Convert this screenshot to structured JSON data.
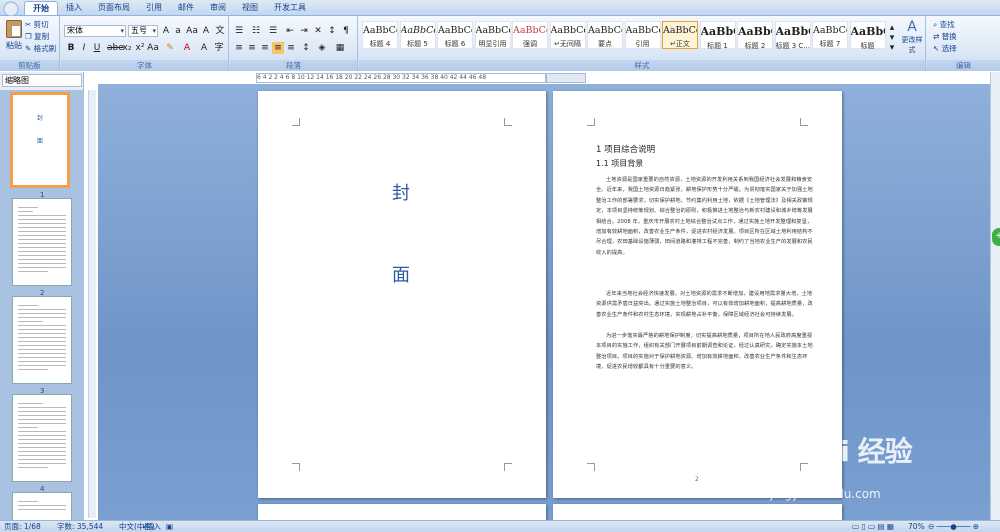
{
  "tabs": [
    "开始",
    "插入",
    "页面布局",
    "引用",
    "邮件",
    "审阅",
    "视图",
    "开发工具"
  ],
  "ribbon": {
    "clipboard": {
      "paste": "粘贴",
      "cut": "剪切",
      "copy": "复制",
      "format_painter": "格式刷",
      "label": "剪贴板"
    },
    "font": {
      "font_name": "宋体",
      "font_size": "五号",
      "label": "字体"
    },
    "paragraph": {
      "label": "段落"
    },
    "styles": {
      "label": "样式",
      "items": [
        {
          "sample": "AaBbCcI",
          "name": "标题 4"
        },
        {
          "sample": "AaBbCc",
          "name": "标题 5"
        },
        {
          "sample": "AaBbCcI",
          "name": "标题 6"
        },
        {
          "sample": "AaBbCcD",
          "name": "明显引用"
        },
        {
          "sample": "AaBbCcDd",
          "name": "强调"
        },
        {
          "sample": "AaBbCcDd",
          "name": "↵无间隔"
        },
        {
          "sample": "AaBbCcDd",
          "name": "要点"
        },
        {
          "sample": "AaBbCcDd",
          "name": "引用"
        },
        {
          "sample": "AaBbCcDd",
          "name": "↵正文"
        },
        {
          "sample": "AaBbC",
          "name": "标题 1"
        },
        {
          "sample": "AaBbC",
          "name": "标题 2"
        },
        {
          "sample": "AaBbC",
          "name": "标题 3 C..."
        },
        {
          "sample": "AaBbCcI",
          "name": "标题 7"
        },
        {
          "sample": "AaBbC",
          "name": "标题"
        }
      ],
      "change_styles": "更改样式"
    },
    "editing": {
      "find": "查找",
      "replace": "替换",
      "select": "选择",
      "label": "编辑"
    }
  },
  "left_panel": {
    "view_mode": "缩略图",
    "thumbs": [
      {
        "num": "1",
        "cover": [
          "封",
          "面"
        ]
      },
      {
        "num": "2"
      },
      {
        "num": "3"
      },
      {
        "num": "4"
      }
    ]
  },
  "ruler": "6  4  2     2  4  6  8  10  12  14  16  18  20  22  24  26  28  30  32  34  36  38  40  42     44  46  48",
  "cover_page": {
    "char1": "封",
    "char2": "面"
  },
  "content_page": {
    "heading1": "1 项目综合说明",
    "heading2": "1.1 项目背景",
    "paragraphs": [
      "土地资源是国家重要的自然资源，土地资源的开发利用关系到我国经济社会发展和粮食安全。近年来，我国土地资源日趋紧张，耕地保护形势十分严峻。为贯彻落实国家关于加强土地整治工作的部署要求，切实保护耕地、节约集约利用土地，依据《土地管理法》及相关政策规定，本项目坚持统筹规划、综合整治的原则，积极推进土地整治与新农村建设和城乡统筹发展相结合。2008 年，重庆市开展农村土地综合整治试点工作，通过实施土地开发整理和复垦，增加有效耕地面积，改善农业生产条件，促进农村经济发展。项目区所在区域土地利用结构不尽合理，农田基础设施薄弱，田间道路和灌排工程不完善，制约了当地农业生产的发展和农民收入的提高。",
      "近年来当地社会经济快速发展，对土地资源的需求不断增加，建设用地需求量大增，土地资源供需矛盾日益突出。通过实施土地整治项目，可以有效增加耕地面积，提高耕地质量，改善农业生产条件和农村生态环境，实现耕地占补平衡，保障区域经济社会可持续发展。",
      "为进一步落实最严格的耕地保护制度，切实提高耕地质量，项目所在地人民政府高度重视本项目的实施工作，组织有关部门开展项目前期调查和论证，经过认真研究，确定实施本土地整治项目。项目的实施对于保护耕地资源、增加有效耕地面积、改善农业生产条件和生态环境、促进农民增收都具有十分重要的意义。"
    ],
    "page_num": "2"
  },
  "status_bar": {
    "page": "页面: 1/68",
    "words": "字数: 35,544",
    "lang": "中文(中国)",
    "insert": "插入",
    "zoom": "70%"
  },
  "watermark": {
    "brand": "Bai 经验",
    "url": "jingyan.baidu.com"
  }
}
